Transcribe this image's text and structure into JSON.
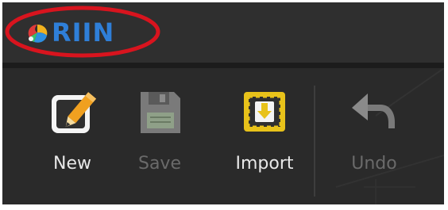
{
  "app": {
    "logo_text": "RIIN"
  },
  "toolbar": {
    "items": [
      {
        "label": "New",
        "icon": "new-pencil-icon",
        "enabled": true
      },
      {
        "label": "Save",
        "icon": "save-floppy-icon",
        "enabled": false
      },
      {
        "label": "Import",
        "icon": "import-arrow-icon",
        "enabled": true
      },
      {
        "label": "Undo",
        "icon": "undo-arrow-icon",
        "enabled": false
      }
    ]
  },
  "colors": {
    "highlight": "#d8141e",
    "logo_blue": "#2f7fd8",
    "import_accent": "#e8c21a",
    "pencil_orange": "#f0a020"
  }
}
